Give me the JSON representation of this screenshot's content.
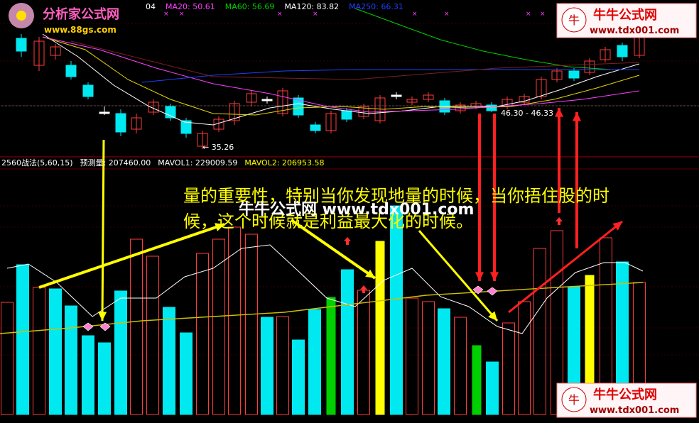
{
  "colors": {
    "bg": "#000000",
    "up_candle": "#ff3c3c",
    "down_candle": "#00e8f0",
    "ma_white": "#ffffff",
    "ma_yellow": "#e8d800",
    "ma20": "#ff40ff",
    "ma60": "#00d000",
    "ma120": "#ffffff",
    "ma250": "#2040ff",
    "vol_up": "#ff3c3c",
    "vol_down": "#00e8f0",
    "vol_yellow": "#ffff00",
    "vol_green": "#00d000",
    "annot": "#ffff00",
    "arrow_yellow": "#ffff00",
    "arrow_red": "#ff2020",
    "separator": "#c00000"
  },
  "price_panel": {
    "ma_header": [
      {
        "label": "04",
        "color": "#ffffff"
      },
      {
        "label": "MA20: 50.61",
        "color": "#ff40ff"
      },
      {
        "label": "MA60: 56.69",
        "color": "#00d000"
      },
      {
        "label": "MA120: 83.82",
        "color": "#ffffff"
      },
      {
        "label": "MA250: 66.31",
        "color": "#2040ff"
      }
    ],
    "low_marker": "← 35.26",
    "range_label": "46.30 - 46.33"
  },
  "volume_panel": {
    "header": [
      {
        "label": "2560战法(5,60,15)",
        "color": "#ffffff"
      },
      {
        "label": "预测量: 207460.00",
        "color": "#ffffff"
      },
      {
        "label": "MAVOL1: 229009.59",
        "color": "#ffffff"
      },
      {
        "label": "MAVOL2: 206953.58",
        "color": "#ffff00"
      }
    ],
    "annotation_line1": "量的重要性，特别当你发现地量的时候，当你捂住股的时",
    "annotation_line2": "候，这个时候就是利益最大化的时候。",
    "overlay_watermark": "牛牛公式网  www.tdx001.com"
  },
  "watermarks": {
    "top_left_title": "分析家公式网",
    "top_left_url": "www.88gs.com",
    "top_right_title": "牛牛公式网",
    "top_right_url": "www.tdx001.com",
    "bottom_right_title": "牛牛公式网",
    "bottom_right_url": "www.tdx001.com"
  }
}
